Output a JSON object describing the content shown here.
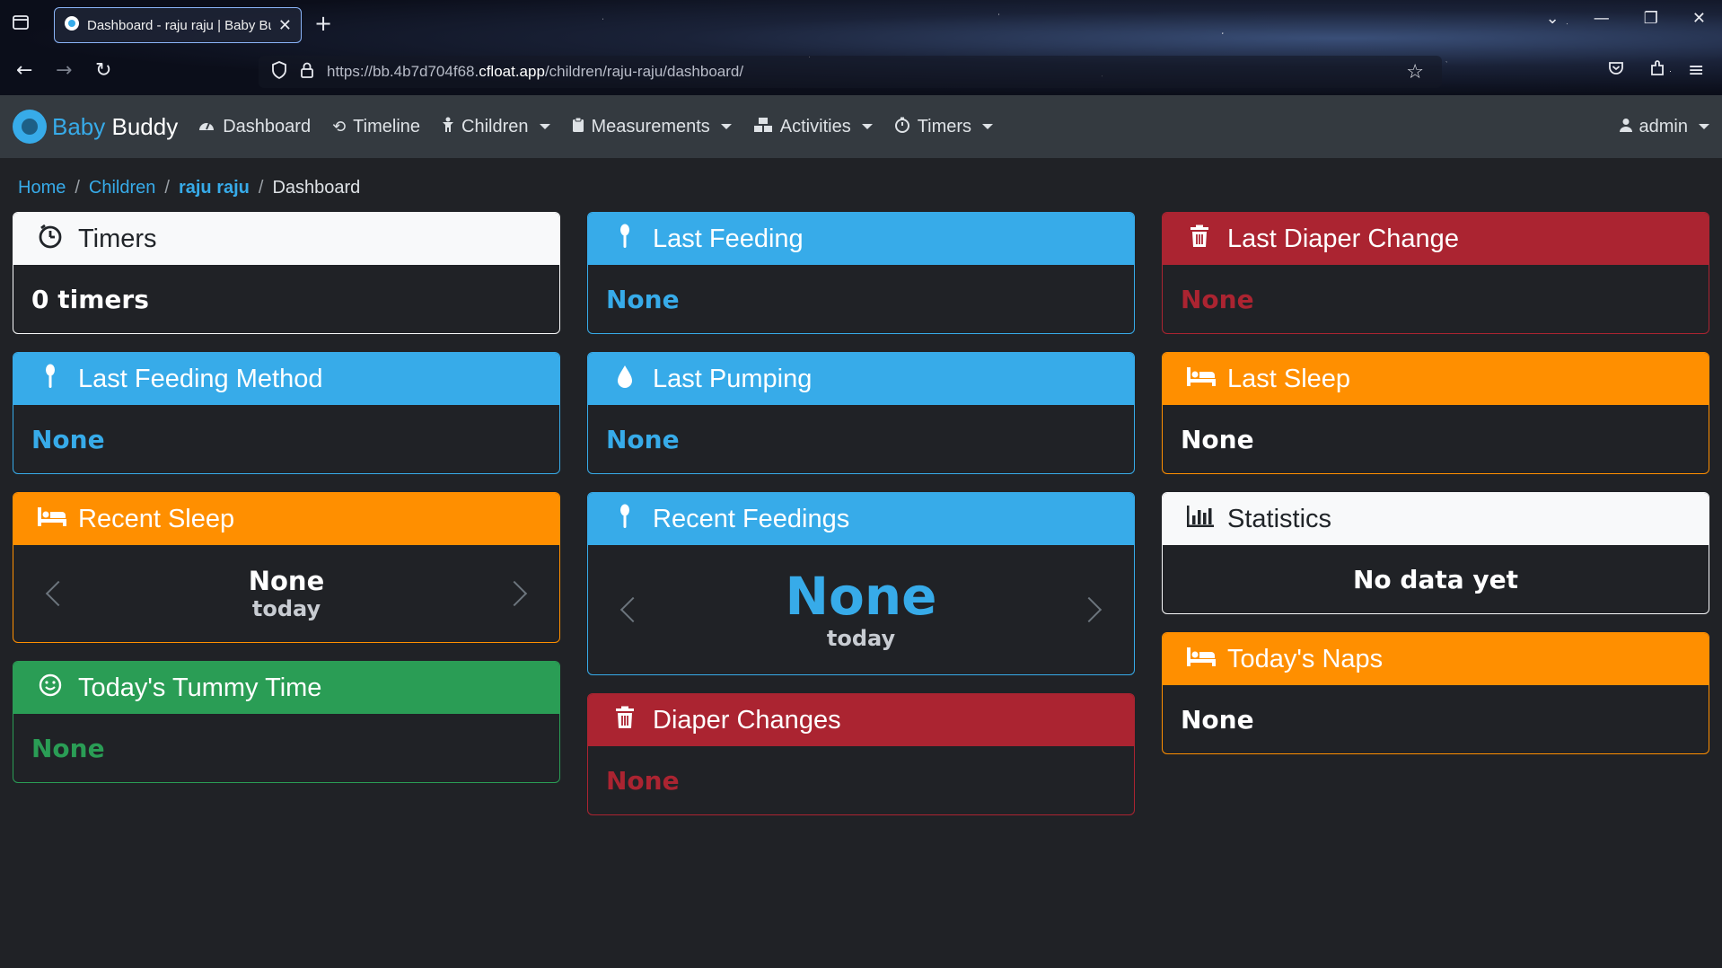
{
  "browser": {
    "tab_title": "Dashboard - raju raju | Baby Buddy",
    "url_prefix": "https://bb.4b7d704f68.",
    "url_host": "cfloat.app",
    "url_path": "/children/raju-raju/dashboard/"
  },
  "navbar": {
    "brand_first": "Baby",
    "brand_second": "Buddy",
    "items": [
      {
        "label": "Dashboard",
        "icon": "dashboard-icon"
      },
      {
        "label": "Timeline",
        "icon": "history-icon"
      },
      {
        "label": "Children",
        "icon": "child-icon"
      },
      {
        "label": "Measurements",
        "icon": "clipboard-icon"
      },
      {
        "label": "Activities",
        "icon": "activities-icon"
      },
      {
        "label": "Timers",
        "icon": "timer-icon"
      }
    ],
    "user": "admin"
  },
  "breadcrumb": {
    "home": "Home",
    "children": "Children",
    "child": "raju raju",
    "current": "Dashboard"
  },
  "cards": {
    "timers": {
      "title": "Timers",
      "value": "0 timers"
    },
    "last_feeding": {
      "title": "Last Feeding",
      "value": "None"
    },
    "last_diaper_change": {
      "title": "Last Diaper Change",
      "value": "None"
    },
    "last_feeding_method": {
      "title": "Last Feeding Method",
      "value": "None"
    },
    "last_pumping": {
      "title": "Last Pumping",
      "value": "None"
    },
    "last_sleep": {
      "title": "Last Sleep",
      "value": "None"
    },
    "recent_sleep": {
      "title": "Recent Sleep",
      "value": "None",
      "sub": "today"
    },
    "recent_feedings": {
      "title": "Recent Feedings",
      "value": "None",
      "sub": "today"
    },
    "statistics": {
      "title": "Statistics",
      "value": "No data yet"
    },
    "tummy_time": {
      "title": "Today's Tummy Time",
      "value": "None"
    },
    "diaper_changes": {
      "title": "Diaper Changes",
      "value": "None"
    },
    "todays_naps": {
      "title": "Today's Naps",
      "value": "None"
    }
  },
  "colors": {
    "primary": "#37abe9",
    "danger": "#ab2431",
    "warning": "#ff8f00",
    "success": "#2a9d55",
    "light": "#f8f9fa"
  }
}
